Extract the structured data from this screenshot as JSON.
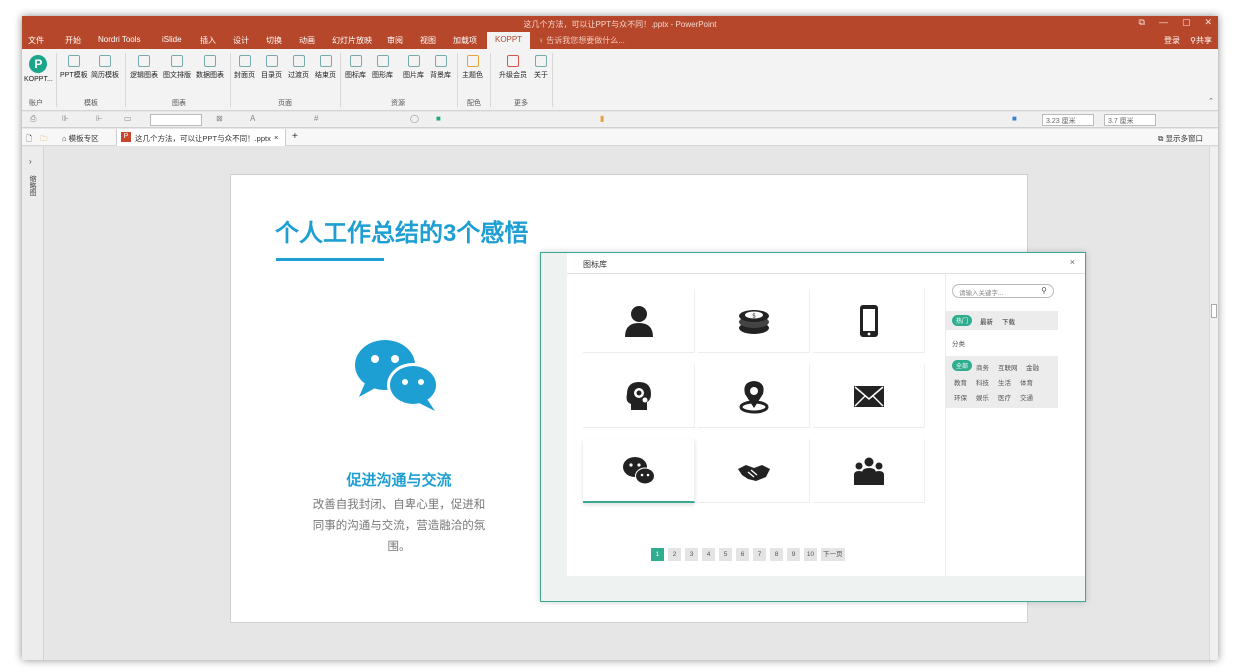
{
  "window": {
    "title": "这几个方法，可以让PPT与众不同！.pptx - PowerPoint",
    "controls": [
      "⧉",
      "—",
      "▢",
      "✕"
    ]
  },
  "menu": {
    "tabs": [
      "文件",
      "开始",
      "Nordri Tools",
      "iSlide",
      "插入",
      "设计",
      "切换",
      "动画",
      "幻灯片放映",
      "审阅",
      "视图",
      "加载项",
      "KOPPT"
    ],
    "active": "KOPPT",
    "tell_me": "告诉我您想要做什么...",
    "login": "登录",
    "share": "共享"
  },
  "ribbon": {
    "buttons": [
      "KOPPT...",
      "PPT模板",
      "简历模板",
      "逻辑图表",
      "图文排版",
      "数据图表",
      "封面页",
      "目录页",
      "过渡页",
      "结束页",
      "图标库",
      "图形库",
      "图片库",
      "背景库",
      "主题色",
      "升级会员",
      "关于"
    ],
    "groups": [
      "账户",
      "模板",
      "图表",
      "页面",
      "资源",
      "配色",
      "更多"
    ]
  },
  "format_toolbar": {
    "width_value": "3.23 厘米",
    "height_value": "3.7 厘米"
  },
  "doc_tabs": {
    "home": "模板专区",
    "file": "这几个方法，可以让PPT与众不同！.pptx",
    "show_multi": "显示多窗口"
  },
  "left_pane": {
    "label": "缩略图"
  },
  "slide": {
    "title": "个人工作总结的3个感悟",
    "subheading": "促进沟通与交流",
    "body": "改善自我封闭、自卑心里，促进和同事的沟通与交流，营造融洽的氛围。"
  },
  "icon_dialog": {
    "title": "图标库",
    "close": "×",
    "icons": [
      "user-icon",
      "coins-icon",
      "mobile-phone-icon",
      "brain-gear-icon",
      "location-pin-icon",
      "envelope-icon",
      "wechat-icon",
      "handshake-icon",
      "group-icon"
    ],
    "selected_index": 6,
    "pagination": [
      "1",
      "2",
      "3",
      "4",
      "5",
      "6",
      "7",
      "8",
      "9",
      "10",
      "下一页"
    ],
    "active_page": "1",
    "search_placeholder": "请输入关键字...",
    "filters": {
      "hot": "热门",
      "latest": "最新",
      "download": "下载"
    },
    "category_label": "分类",
    "categories": [
      "全部",
      "商务",
      "互联网",
      "金融",
      "教育",
      "科技",
      "生活",
      "体育",
      "环保",
      "娱乐",
      "医疗",
      "交通"
    ]
  },
  "colors": {
    "accent_red": "#b7472a",
    "slide_blue": "#1e9fd3",
    "dialog_green": "#2fae8f"
  }
}
